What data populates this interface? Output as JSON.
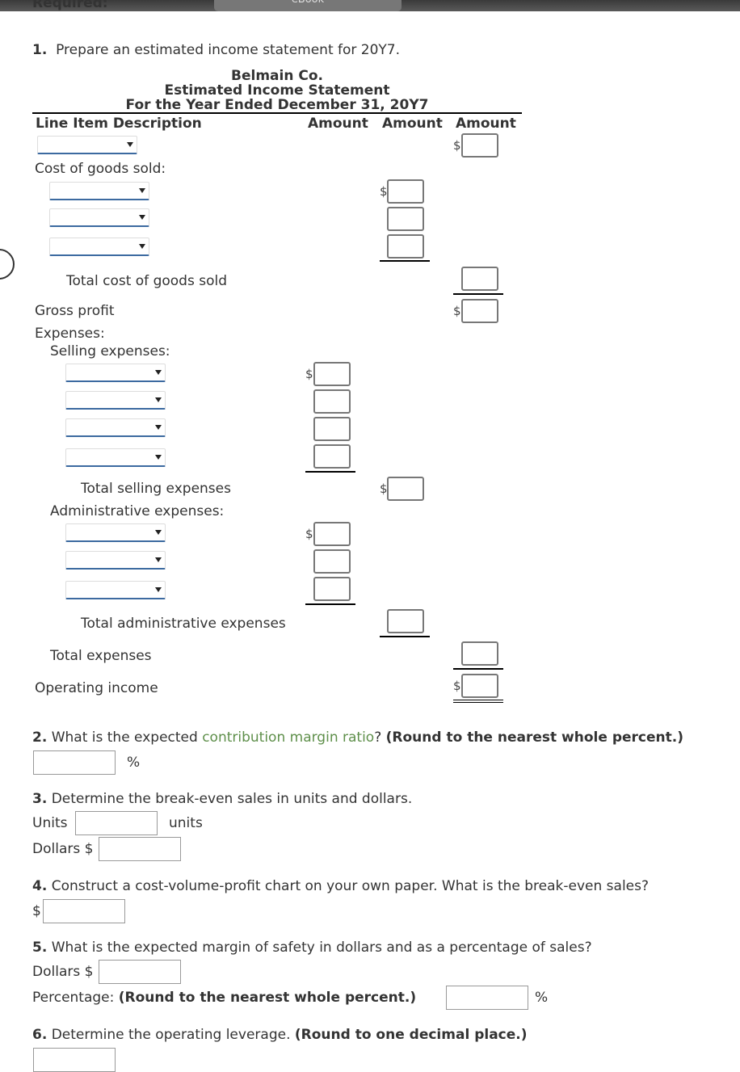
{
  "topbar": {
    "tab": "eBook",
    "partial_heading": "Required:"
  },
  "q1": {
    "num": "1.",
    "text": "Prepare an estimated income statement for 20Y7."
  },
  "statement": {
    "company": "Belmain Co.",
    "title": "Estimated Income Statement",
    "period": "For the Year Ended December 31, 20Y7",
    "headers": [
      "Line Item Description",
      "Amount",
      "Amount",
      "Amount"
    ],
    "labels": {
      "cogs": "Cost of goods sold:",
      "total_cogs": "Total cost of goods sold",
      "gross_profit": "Gross profit",
      "expenses": "Expenses:",
      "selling": "Selling expenses:",
      "total_selling": "Total selling expenses",
      "admin": "Administrative expenses:",
      "total_admin": "Total administrative expenses",
      "total_expenses": "Total expenses",
      "operating_income": "Operating income"
    },
    "currency": "$"
  },
  "q2": {
    "num": "2.",
    "pre": "What is the expected ",
    "link": "contribution margin ratio",
    "post": "?",
    "note": "(Round to the nearest whole percent.)",
    "unit": "%"
  },
  "q3": {
    "num": "3.",
    "text": "Determine the break-even sales in units and dollars.",
    "units_label": "Units",
    "units_unit": "units",
    "dollars_label": "Dollars $"
  },
  "q4": {
    "num": "4.",
    "text": "Construct a cost-volume-profit chart on your own paper. What is the break-even sales?",
    "currency": "$"
  },
  "q5": {
    "num": "5.",
    "text": "What is the expected margin of safety in dollars and as a percentage of sales?",
    "dollars_label": "Dollars $",
    "pct_label": "Percentage: ",
    "pct_note": "(Round to the nearest whole percent.)",
    "unit": "%"
  },
  "q6": {
    "num": "6.",
    "text": "Determine the operating leverage. ",
    "note": "(Round to one decimal place.)"
  }
}
